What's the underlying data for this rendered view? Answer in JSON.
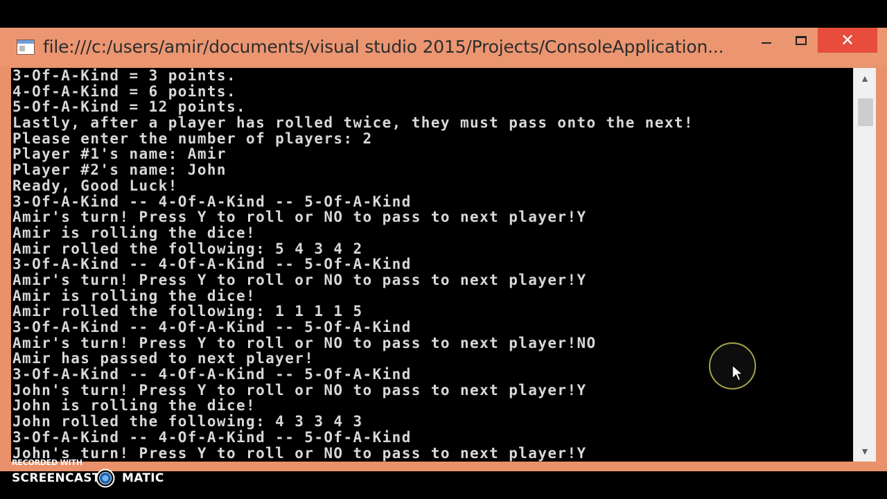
{
  "window": {
    "title": "file:///c:/users/amir/documents/visual studio 2015/Projects/ConsoleApplication...",
    "minimize_glyph": "minimize-icon",
    "maximize_glyph": "maximize-icon",
    "close_label": "✕"
  },
  "console": {
    "lines": [
      "3-Of-A-Kind = 3 points.",
      "4-Of-A-Kind = 6 points.",
      "5-Of-A-Kind = 12 points.",
      "Lastly, after a player has rolled twice, they must pass onto the next!",
      "Please enter the number of players: 2",
      "Player #1's name: Amir",
      "Player #2's name: John",
      "Ready, Good Luck!",
      "3-Of-A-Kind -- 4-Of-A-Kind -- 5-Of-A-Kind",
      "Amir's turn! Press Y to roll or NO to pass to next player!Y",
      "Amir is rolling the dice!",
      "Amir rolled the following: 5 4 3 4 2",
      "3-Of-A-Kind -- 4-Of-A-Kind -- 5-Of-A-Kind",
      "Amir's turn! Press Y to roll or NO to pass to next player!Y",
      "Amir is rolling the dice!",
      "Amir rolled the following: 1 1 1 1 5",
      "3-Of-A-Kind -- 4-Of-A-Kind -- 5-Of-A-Kind",
      "Amir's turn! Press Y to roll or NO to pass to next player!NO",
      "Amir has passed to next player!",
      "3-Of-A-Kind -- 4-Of-A-Kind -- 5-Of-A-Kind",
      "John's turn! Press Y to roll or NO to pass to next player!Y",
      "John is rolling the dice!",
      "John rolled the following: 4 3 3 4 3",
      "3-Of-A-Kind -- 4-Of-A-Kind -- 5-Of-A-Kind",
      "John's turn! Press Y to roll or NO to pass to next player!Y"
    ]
  },
  "scrollbar": {
    "up_icon": "▲",
    "down_icon": "▼"
  },
  "watermark": {
    "recorded_with": "RECORDED WITH",
    "brand_left": "SCREENCAST",
    "brand_right": "MATIC"
  },
  "colors": {
    "frame": "#eb9671",
    "close_button": "#e74c3c",
    "console_bg": "#000000",
    "console_text": "#d8d8d8"
  }
}
